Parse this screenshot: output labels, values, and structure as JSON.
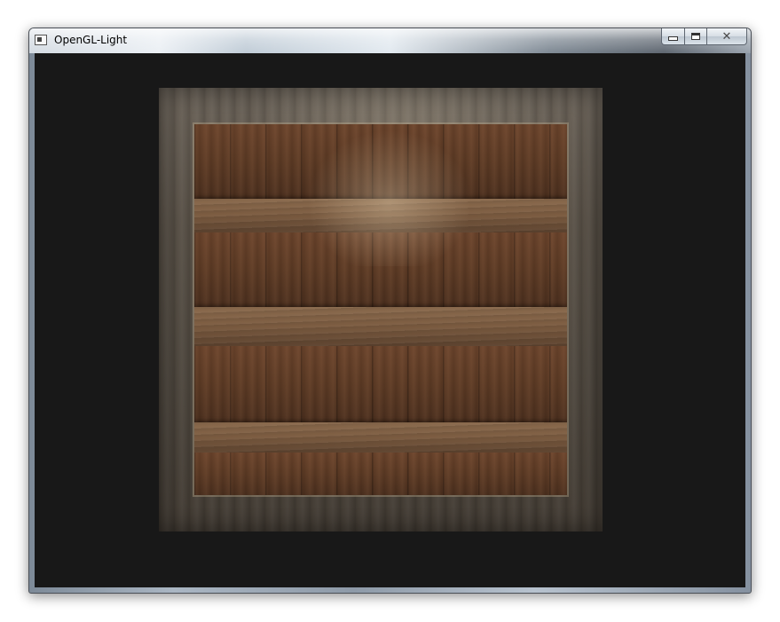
{
  "window": {
    "title": "OpenGL-Light",
    "icon": "app-window-icon",
    "controls": {
      "minimize_icon": "minimize-icon",
      "maximize_icon": "maximize-icon",
      "close_glyph": "✕"
    }
  },
  "viewport": {
    "background": "#181818",
    "object": "textured-wooden-crate"
  }
}
